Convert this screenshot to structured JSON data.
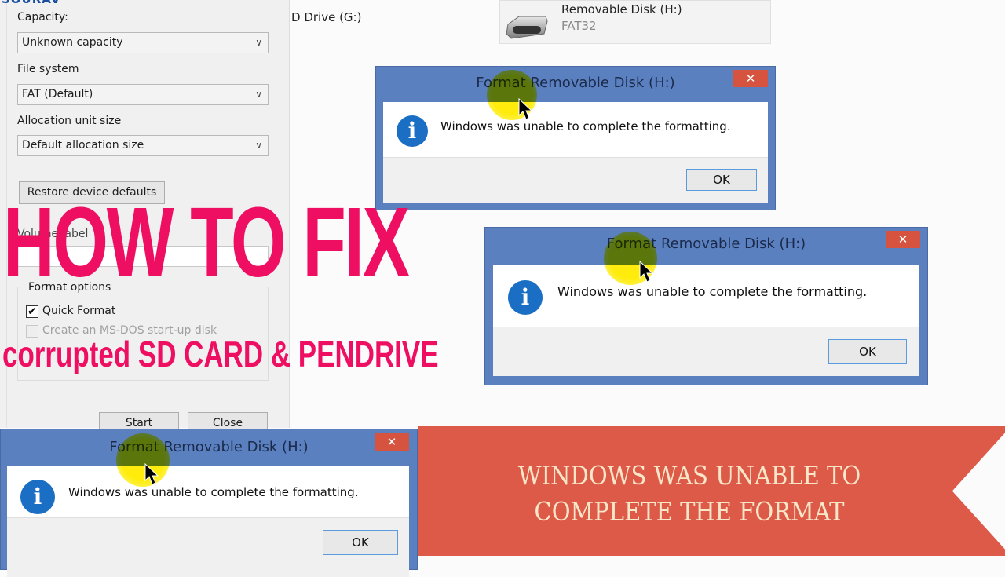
{
  "brand": "SOURAV",
  "format_panel": {
    "capacity_label": "Capacity:",
    "capacity_value": "Unknown capacity",
    "file_system_label": "File system",
    "file_system_value": "FAT (Default)",
    "allocation_label": "Allocation unit size",
    "allocation_value": "Default allocation size",
    "restore_button": "Restore device defaults",
    "volume_label": "Volume label",
    "volume_value": "",
    "format_options_label": "Format options",
    "quick_format_label": "Quick Format",
    "quick_format_checked": true,
    "msdos_label": "Create an MS-DOS start-up disk",
    "msdos_checked": false,
    "start_button": "Start",
    "close_button": "Close",
    "chevron": "∨"
  },
  "explorer": {
    "drive_g": "D Drive (G:)",
    "drive_h_name": "Removable Disk (H:)",
    "drive_h_fs": "FAT32"
  },
  "dialogs": [
    {
      "title": "Format Removable Disk (H:)",
      "message": "Windows was unable to complete the formatting.",
      "ok": "OK",
      "close": "✕",
      "icon": "i"
    },
    {
      "title": "Format Removable Disk (H:)",
      "message": "Windows was unable to complete the formatting.",
      "ok": "OK",
      "close": "✕",
      "icon": "i"
    },
    {
      "title": "Format Removable Disk (H:)",
      "message": "Windows was unable to complete the formatting.",
      "ok": "OK",
      "close": "✕",
      "icon": "i"
    }
  ],
  "overlay": {
    "headline": "HOW TO FIX",
    "subhead": "corrupted SD CARD & PENDRIVE",
    "banner_line1": "WINDOWS WAS UNABLE TO",
    "banner_line2": "COMPLETE THE FORMAT"
  },
  "colors": {
    "headline": "#ee0f62",
    "banner": "#dd5a49",
    "dialog_frame": "#5b80c0",
    "close_button": "#d6533f",
    "info_icon": "#1a6fc4"
  }
}
